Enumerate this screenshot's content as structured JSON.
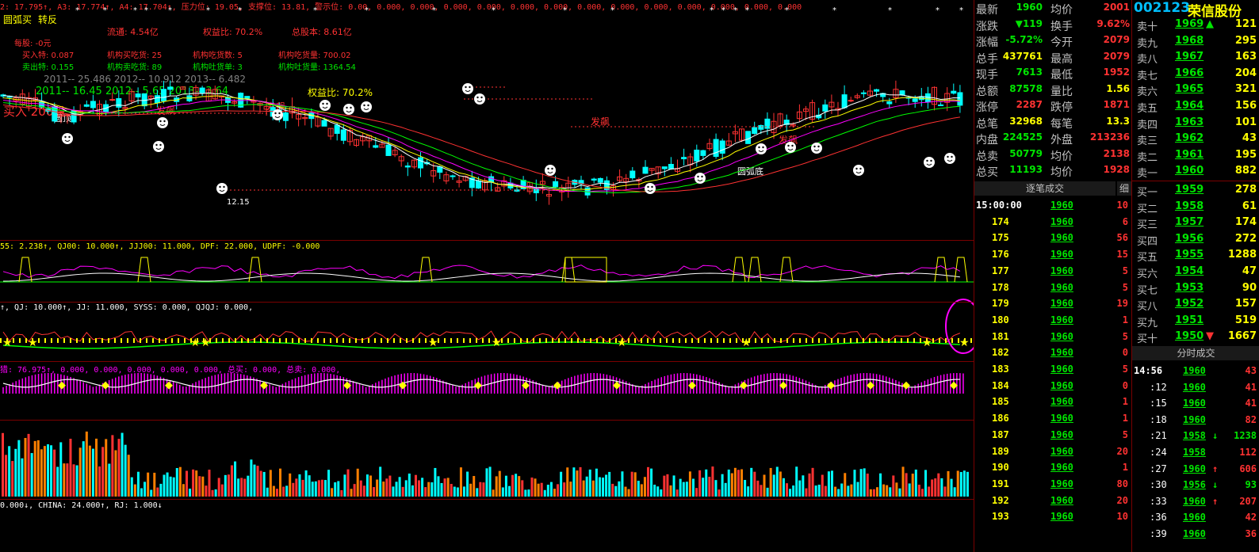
{
  "colors": {
    "up": "#ff3232",
    "down": "#00e600",
    "neutral": "#ffffff",
    "yellow": "#ffff00",
    "cyan": "#00ffff",
    "magenta": "#ff00ff",
    "green": "#00ff00",
    "label": "#c0c0c0",
    "highlight": "#ffff00"
  },
  "main_chart": {
    "top_line": "2: 17.795↑, A3: 17.774↑, A4: 17.704↑, 压力位: 19.05, 支撑位: 13.81, 警示位: 0.00, 0.000, 0.000, 0.000, 0.000, 0.000, 0.000, 0.000, 0.000, 0.000, 0.000, 0.000, 0.000, 0.000",
    "tags": [
      "圆弧买",
      "转反"
    ],
    "info": [
      {
        "a": "流通: 4.54亿",
        "b": "权益比: 70.2%",
        "c": "总股本: 8.61亿"
      },
      {
        "a": "每股: -0元",
        "b": "",
        "c": ""
      }
    ],
    "fund_rows": [
      {
        "a": "买入特: 0.087",
        "b": "机构买吃货: 25",
        "c": "机构吃货数: 5",
        "d": "机构吃货量: 700.02"
      },
      {
        "a": "卖出特: 0.155",
        "b": "机构卖吃货: 89",
        "c": "机构吐货单: 3",
        "d": "机构吐货量: 1364.54"
      }
    ],
    "yearline1": "2011-- 25.486    2012-- 10.912    2013-- 6.482",
    "yearline2": "2011-- 16.45    2012-- 5.65    2013-- 3.64",
    "equity_ratio": "权益比: 70.2%",
    "buy_tag": "买入 200股",
    "chart_labels": {
      "fafeng": "发飙",
      "yuanding": "圆顶",
      "yuanhudi": "圆弧底",
      "low_price": "12.15"
    }
  },
  "indicator1": "55: 2.238↑, QJ00: 10.000↑, JJJ00: 11.000, DPF: 22.000, UDPF: -0.000",
  "indicator2": "↑, QJ: 10.000↑, JJ: 11.000, SYSS: 0.000, QJQJ: 0.000,",
  "indicator3": "猎: 76.975↑, 0.000, 0.000, 0.000, 0.000, 0.000, 总买: 0.000, 总卖: 0.000,",
  "indicator4": "0.000↓, CHINA: 24.000↑, RJ: 1.000↓",
  "quote": {
    "rows": [
      {
        "l1": "最新",
        "v1": "1960",
        "l2": "均价",
        "v2": "2001"
      },
      {
        "l1": "涨跌",
        "v1": "▼119",
        "l2": "换手",
        "v2": "9.62%"
      },
      {
        "l1": "涨幅",
        "v1": "-5.72%",
        "l2": "今开",
        "v2": "2079"
      },
      {
        "l1": "总手",
        "v1": "437761",
        "l2": "最高",
        "v2": "2079"
      },
      {
        "l1": "现手",
        "v1": "7613",
        "l2": "最低",
        "v2": "1952"
      },
      {
        "l1": "总额",
        "v1": "87578",
        "l2": "量比",
        "v2": "1.56"
      },
      {
        "l1": "涨停",
        "v1": "2287",
        "l2": "跌停",
        "v2": "1871"
      },
      {
        "l1": "总笔",
        "v1": "32968",
        "l2": "每笔",
        "v2": "13.3"
      },
      {
        "l1": "内盘",
        "v1": "224525",
        "l2": "外盘",
        "v2": "213236"
      },
      {
        "l1": "总卖",
        "v1": "50779",
        "l2": "均价",
        "v2": "2138"
      },
      {
        "l1": "总买",
        "v1": "11193",
        "l2": "均价",
        "v2": "1928"
      }
    ],
    "tick_header": "逐笔成交",
    "tick_tab": "细",
    "ticks": [
      {
        "t": "15:00:00",
        "p": "1960",
        "v": "10"
      },
      {
        "t": "174",
        "p": "1960",
        "v": "6"
      },
      {
        "t": "175",
        "p": "1960",
        "v": "56"
      },
      {
        "t": "176",
        "p": "1960",
        "v": "15"
      },
      {
        "t": "177",
        "p": "1960",
        "v": "5"
      },
      {
        "t": "178",
        "p": "1960",
        "v": "5"
      },
      {
        "t": "179",
        "p": "1960",
        "v": "19"
      },
      {
        "t": "180",
        "p": "1960",
        "v": "1"
      },
      {
        "t": "181",
        "p": "1960",
        "v": "5"
      },
      {
        "t": "182",
        "p": "1960",
        "v": "0"
      },
      {
        "t": "183",
        "p": "1960",
        "v": "5"
      },
      {
        "t": "184",
        "p": "1960",
        "v": "0"
      },
      {
        "t": "185",
        "p": "1960",
        "v": "1"
      },
      {
        "t": "186",
        "p": "1960",
        "v": "1"
      },
      {
        "t": "187",
        "p": "1960",
        "v": "5"
      },
      {
        "t": "189",
        "p": "1960",
        "v": "20"
      },
      {
        "t": "190",
        "p": "1960",
        "v": "1"
      },
      {
        "t": "191",
        "p": "1960",
        "v": "80"
      },
      {
        "t": "192",
        "p": "1960",
        "v": "20"
      },
      {
        "t": "193",
        "p": "1960",
        "v": "10"
      }
    ]
  },
  "book": {
    "code": "002123",
    "name": "荣信股份",
    "asks": [
      {
        "l": "卖十",
        "p": "1969",
        "ch": "▲",
        "v": "121"
      },
      {
        "l": "卖九",
        "p": "1968",
        "ch": "",
        "v": "295"
      },
      {
        "l": "卖八",
        "p": "1967",
        "ch": "",
        "v": "163"
      },
      {
        "l": "卖七",
        "p": "1966",
        "ch": "",
        "v": "204"
      },
      {
        "l": "卖六",
        "p": "1965",
        "ch": "",
        "v": "321"
      },
      {
        "l": "卖五",
        "p": "1964",
        "ch": "",
        "v": "156"
      },
      {
        "l": "卖四",
        "p": "1963",
        "ch": "",
        "v": "101"
      },
      {
        "l": "卖三",
        "p": "1962",
        "ch": "",
        "v": "43"
      },
      {
        "l": "卖二",
        "p": "1961",
        "ch": "",
        "v": "195"
      },
      {
        "l": "卖一",
        "p": "1960",
        "ch": "",
        "v": "882"
      }
    ],
    "bids": [
      {
        "l": "买一",
        "p": "1959",
        "ch": "",
        "v": "278"
      },
      {
        "l": "买二",
        "p": "1958",
        "ch": "",
        "v": "61"
      },
      {
        "l": "买三",
        "p": "1957",
        "ch": "",
        "v": "174"
      },
      {
        "l": "买四",
        "p": "1956",
        "ch": "",
        "v": "272"
      },
      {
        "l": "买五",
        "p": "1955",
        "ch": "",
        "v": "1288"
      },
      {
        "l": "买六",
        "p": "1954",
        "ch": "",
        "v": "47"
      },
      {
        "l": "买七",
        "p": "1953",
        "ch": "",
        "v": "90"
      },
      {
        "l": "买八",
        "p": "1952",
        "ch": "",
        "v": "157"
      },
      {
        "l": "买九",
        "p": "1951",
        "ch": "",
        "v": "519"
      },
      {
        "l": "买十",
        "p": "1950",
        "ch": "▼",
        "v": "1667"
      }
    ],
    "time_header": "分时成交",
    "trades": [
      {
        "t": "14:56",
        "p": "1960",
        "ar": "",
        "v": "43"
      },
      {
        "t": ":12",
        "p": "1960",
        "ar": "",
        "v": "41"
      },
      {
        "t": ":15",
        "p": "1960",
        "ar": "",
        "v": "41"
      },
      {
        "t": ":18",
        "p": "1960",
        "ar": "",
        "v": "82"
      },
      {
        "t": ":21",
        "p": "1958",
        "ar": "↓",
        "v": "1238"
      },
      {
        "t": ":24",
        "p": "1958",
        "ar": "",
        "v": "112"
      },
      {
        "t": ":27",
        "p": "1960",
        "ar": "↑",
        "v": "606"
      },
      {
        "t": ":30",
        "p": "1956",
        "ar": "↓",
        "v": "93"
      },
      {
        "t": ":33",
        "p": "1960",
        "ar": "↑",
        "v": "207"
      },
      {
        "t": ":36",
        "p": "1960",
        "ar": "",
        "v": "42"
      },
      {
        "t": ":39",
        "p": "1960",
        "ar": "",
        "v": "36"
      }
    ]
  }
}
